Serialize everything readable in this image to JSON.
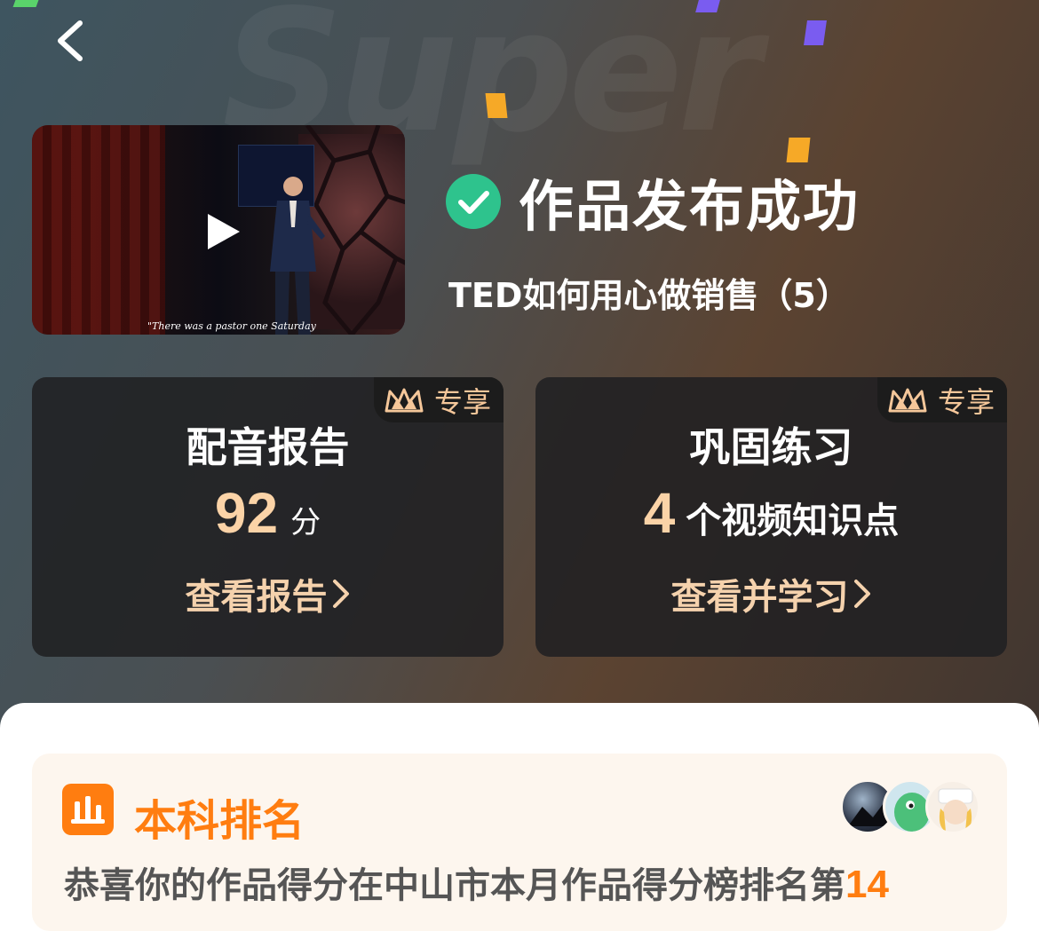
{
  "header": {
    "back_icon": "chevron-left-icon",
    "watermark": "Super"
  },
  "video": {
    "caption": "\"There was a pastor one Saturday",
    "play_icon": "play-icon"
  },
  "status": {
    "icon": "check-circle-icon",
    "title": "作品发布成功",
    "work_title": "TED如何用心做销售（5）"
  },
  "cards": {
    "report": {
      "badge": "专享",
      "title": "配音报告",
      "score": "92",
      "unit": "分",
      "link": "查看报告"
    },
    "practice": {
      "badge": "专享",
      "title": "巩固练习",
      "count": "4",
      "unit": "个视频知识点",
      "link": "查看并学习"
    }
  },
  "ranking": {
    "icon": "bar-chart-icon",
    "title": "本科排名",
    "desc_prefix": "恭喜你的作品得分在中山市本月作品得分榜排名第",
    "rank": "14"
  },
  "colors": {
    "accent_orange": "#ff7d10",
    "gold": "#fbd3a7",
    "success_green": "#2ec38d"
  }
}
